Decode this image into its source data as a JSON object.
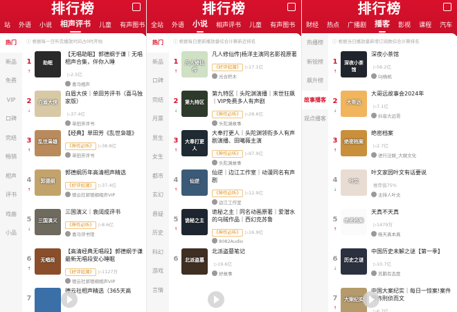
{
  "header_title": "排行榜",
  "colors": {
    "brand": "#d8102b",
    "tag": "#e0921a",
    "up": "#d8102b",
    "down": "#3aa55b"
  },
  "panels": [
    {
      "tabs": [
        "站",
        "外语",
        "小说",
        "相声评书",
        "儿童",
        "有声图书"
      ],
      "selected_tab": 3,
      "note": "根据每一日听完播放时间占0时开始",
      "sidebar": [
        "热门",
        "新品",
        "免费",
        "VIP",
        "口碑",
        "完结",
        "畅销",
        "相声",
        "评书",
        "戏曲",
        "小品"
      ],
      "selected_side": 0,
      "items": [
        {
          "rank": "1",
          "trend": "↑",
          "title": "【无唱助眠】郭德纲于谦｜无唱相声合集，伴你入睡",
          "tag": "",
          "plays": "▷2.5亿",
          "author": "喜马相声",
          "cover": "#2a2a2a",
          "ctext": "助眠"
        },
        {
          "rank": "2",
          "trend": "↓",
          "title": "白眉大侠｜单田芳评书（喜马独家版）",
          "tag": "",
          "plays": "▷37.4亿",
          "author": "单田芳评书",
          "cover": "#d7c9a5",
          "ctext": "白眉大侠"
        },
        {
          "rank": "3",
          "trend": "↑",
          "title": "【经典】单田芳《乱世枭雄》",
          "tag": "神作必听",
          "plays": "▷38.8亿",
          "author": "单田芳评书",
          "cover": "#b98b5c",
          "ctext": "乱世枭雄"
        },
        {
          "rank": "4",
          "trend": "↑",
          "title": "郭德纲历年高清相声精选",
          "tag": "好评如潮",
          "plays": "▷37.4亿",
          "author": "德云社郭德纲相声VIP",
          "cover": "#c3a36c",
          "ctext": "郭德纲"
        },
        {
          "rank": "5",
          "trend": "↓",
          "title": "三国演义｜袁阔成评书",
          "tag": "神作必听",
          "plays": "▷8.6亿",
          "author": "喜马评书馆",
          "cover": "#6f6a5e",
          "ctext": "三国演义"
        },
        {
          "rank": "6",
          "trend": "↑",
          "title": "【高清经典无唱段】郭德纲于谦最新无唱段安心睡眠",
          "tag": "好评如潮",
          "plays": "▷1127万",
          "author": "德云社郭德纲相声VIP",
          "cover": "#8a4e2a",
          "ctext": "无唱段"
        },
        {
          "rank": "7",
          "trend": "",
          "title": "德云社相声精选（365天高",
          "tag": "",
          "plays": "",
          "author": "",
          "cover": "#3a6fa8",
          "ctext": ""
        }
      ]
    },
    {
      "tabs": [
        "全站",
        "外语",
        "小说",
        "相声评书",
        "儿童",
        "有声图书"
      ],
      "selected_tab": 2,
      "note": "根据每日更新播放量综合计算新近排名",
      "sidebar": [
        "热门",
        "新品",
        "口碑",
        "完结",
        "月票",
        "男生",
        "女生",
        "都市",
        "玄幻",
        "悬疑",
        "历史",
        "科幻",
        "游戏",
        "言情"
      ],
      "selected_side": 0,
      "items": [
        {
          "rank": "1",
          "trend": "↑",
          "title": "凡人修仙传|杨洋主演同名影视原著",
          "tag": "好评如潮",
          "plays": "▷17.1亿",
          "author": "光合积木",
          "cover": "#cfe0c4",
          "ctext": "凡人修仙传"
        },
        {
          "rank": "2",
          "trend": "↓",
          "title": "第九特区｜头陀渊演播｜末世狂飙｜VIP免费多人有声剧",
          "tag": "神作必听",
          "plays": "▷28.6亿",
          "author": "头陀渊故事",
          "cover": "#2e3b2c",
          "ctext": "第九特区"
        },
        {
          "rank": "3",
          "trend": "↑",
          "title": "大奉打更人｜头陀渊领衔多人有声剧演播、田曦薇主演",
          "tag": "神作必听",
          "plays": "▷97.9亿",
          "author": "头陀渊故事",
          "cover": "#1f2a33",
          "ctext": "大奉打更人"
        },
        {
          "rank": "4",
          "trend": "↑",
          "title": "仙逆｜边江工作室｜动漫同名有声剧",
          "tag": "神作必听",
          "plays": "▷12.9亿",
          "author": "边江工作室",
          "cover": "#3b5a77",
          "ctext": "仙逆"
        },
        {
          "rank": "5",
          "trend": "↑",
          "title": "诡秘之主｜同名动画原著｜爱潜水的乌贼作品｜西幻克苏鲁",
          "tag": "神作必听",
          "plays": "▷16.9亿",
          "author": "8082Audio",
          "cover": "#1d2530",
          "ctext": "诡秘之主"
        },
        {
          "rank": "6",
          "trend": "",
          "title": "北派盗墓笔记",
          "tag": "",
          "plays": "▷19.6亿",
          "author": "好故事",
          "cover": "#3f2e22",
          "ctext": "北派盗墓"
        }
      ]
    },
    {
      "tabs": [
        "财经",
        "热点",
        "广播剧",
        "播客",
        "影视",
        "课程",
        "汽车"
      ],
      "selected_tab": 3,
      "note": "根据当日播放量新增订阅数综合计算排名",
      "sidebar": [
        "热播榜",
        "新锐榜",
        "飙升榜",
        "故事播客",
        "观点播客"
      ],
      "selected_side": 3,
      "items": [
        {
          "rank": "1",
          "trend": "↑",
          "title": "深夜小茶馆",
          "tag": "",
          "plays": "▷56.2亿",
          "author": "DJ杨帆",
          "cover": "#20242c",
          "ctext": "深夜小茶馆"
        },
        {
          "rank": "2",
          "trend": "↓",
          "title": "大哥远故事会2024年",
          "tag": "",
          "plays": "▷7.1亿",
          "author": "抖音大远哥",
          "cover": "#f0b55d",
          "ctext": "大哥远"
        },
        {
          "rank": "3",
          "trend": "↑",
          "title": "绝密档案",
          "tag": "",
          "plays": "▷2.7亿",
          "author": "进行泛娱_大娱文化",
          "cover": "#c98f3a",
          "ctext": "绝密档案"
        },
        {
          "rank": "4",
          "trend": "↓",
          "title": "叶文家园叶文有话要说",
          "tag": "",
          "plays": "推荐值75%",
          "author": "主持人叶文",
          "cover": "#e9dcd2",
          "ctext": "叶文"
        },
        {
          "rank": "5",
          "trend": "↑",
          "title": "天真不天真",
          "tag": "",
          "plays": "▷1479万",
          "author": "杨天真本真",
          "cover": "#fbfbfb",
          "ctext": "绝密档案"
        },
        {
          "rank": "6",
          "trend": "↓",
          "title": "中国历史未解之谜【第一季】",
          "tag": "",
          "plays": "▷10.7亿",
          "author": "苏鹏有态度",
          "cover": "#2c3140",
          "ctext": "历史之谜"
        },
        {
          "rank": "7",
          "trend": "↑",
          "title": "中国大案纪实｜每日一惊案!案件恐怖刑侦而文",
          "tag": "",
          "plays": "▷6.7亿",
          "author": "",
          "cover": "#b59a6c",
          "ctext": "大案纪实"
        }
      ]
    }
  ]
}
